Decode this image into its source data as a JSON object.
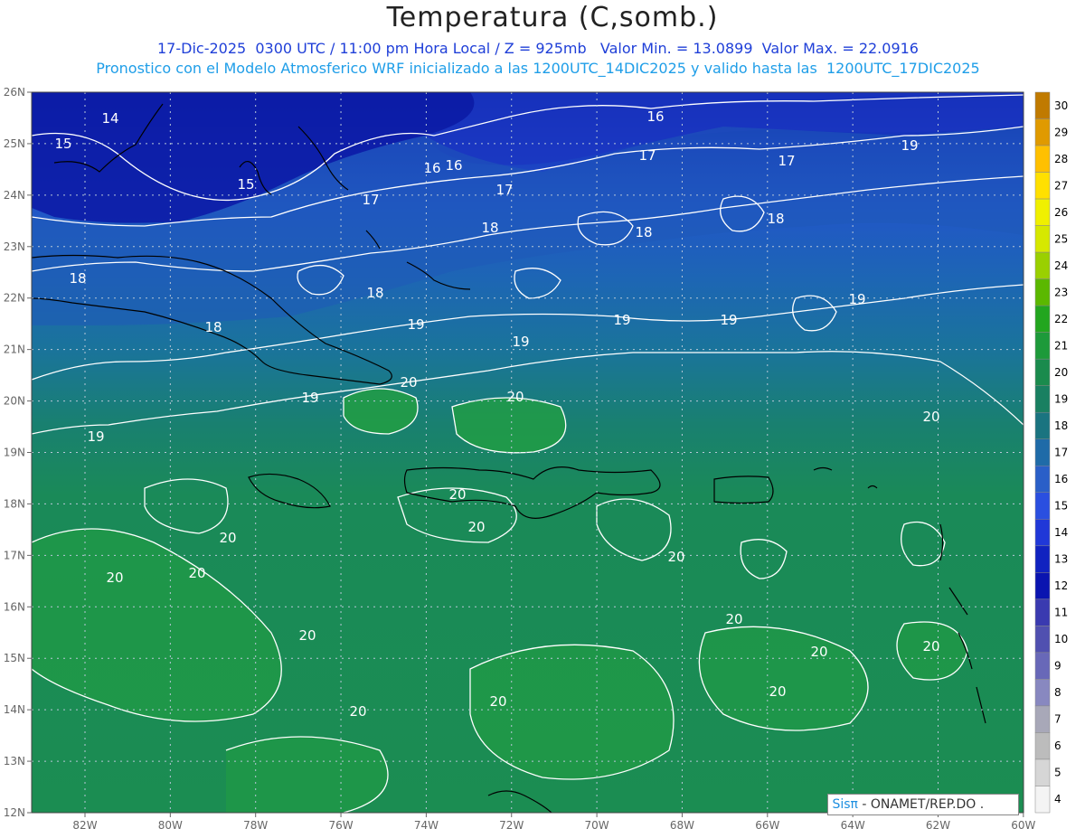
{
  "title": "Temperatura (C,somb.)",
  "subtitle1": "17-Dic-2025  0300 UTC / 11:00 pm Hora Local / Z = 925mb   Valor Min. = 13.0899  Valor Max. = 22.0916",
  "subtitle2": "Pronostico con el Modelo Atmosferico WRF inicializado a las 1200UTC_14DIC2025 y valido hasta las  1200UTC_17DIC2025",
  "credit": {
    "sis": "Sisπ",
    "rest": "- ONAMET/REP.DO ."
  },
  "y_ticks": [
    "26N",
    "25N",
    "24N",
    "23N",
    "22N",
    "21N",
    "20N",
    "19N",
    "18N",
    "17N",
    "16N",
    "15N",
    "14N",
    "13N",
    "12N"
  ],
  "x_ticks": [
    "82W",
    "80W",
    "78W",
    "76W",
    "74W",
    "72W",
    "70W",
    "68W",
    "66W",
    "64W",
    "62W",
    "60W"
  ],
  "colorbar": {
    "levels": [
      "30",
      "29",
      "28",
      "27",
      "26",
      "25",
      "24",
      "23",
      "22",
      "21",
      "20",
      "19",
      "18",
      "17",
      "16",
      "15",
      "14",
      "13",
      "12",
      "11",
      "10",
      "9",
      "8",
      "7",
      "6",
      "5",
      "4"
    ],
    "colors": [
      "#c07a00",
      "#e09a00",
      "#ffc000",
      "#ffe000",
      "#f0f000",
      "#d6e800",
      "#9ad000",
      "#5bb800",
      "#22a61f",
      "#1d9a3a",
      "#1a8b4d",
      "#198061",
      "#1a7480",
      "#1f6ba8",
      "#2a5fc8",
      "#2a4fe0",
      "#2038d8",
      "#1022c0",
      "#0a14b0",
      "#3a3ab0",
      "#5050b0",
      "#6868b8",
      "#8888c0",
      "#a8a8b8",
      "#bcbcbc",
      "#d6d6d6",
      "#f4f4f4"
    ]
  },
  "contour_labels": [
    "14",
    "15",
    "16",
    "16",
    "15",
    "16",
    "17",
    "17",
    "17",
    "17",
    "18",
    "18",
    "18",
    "18",
    "18",
    "18",
    "19",
    "19",
    "19",
    "19",
    "19",
    "19",
    "19",
    "19",
    "20",
    "20",
    "20",
    "20",
    "20",
    "20",
    "20",
    "20",
    "20",
    "20",
    "20",
    "20",
    "20",
    "20",
    "20",
    "20"
  ]
}
